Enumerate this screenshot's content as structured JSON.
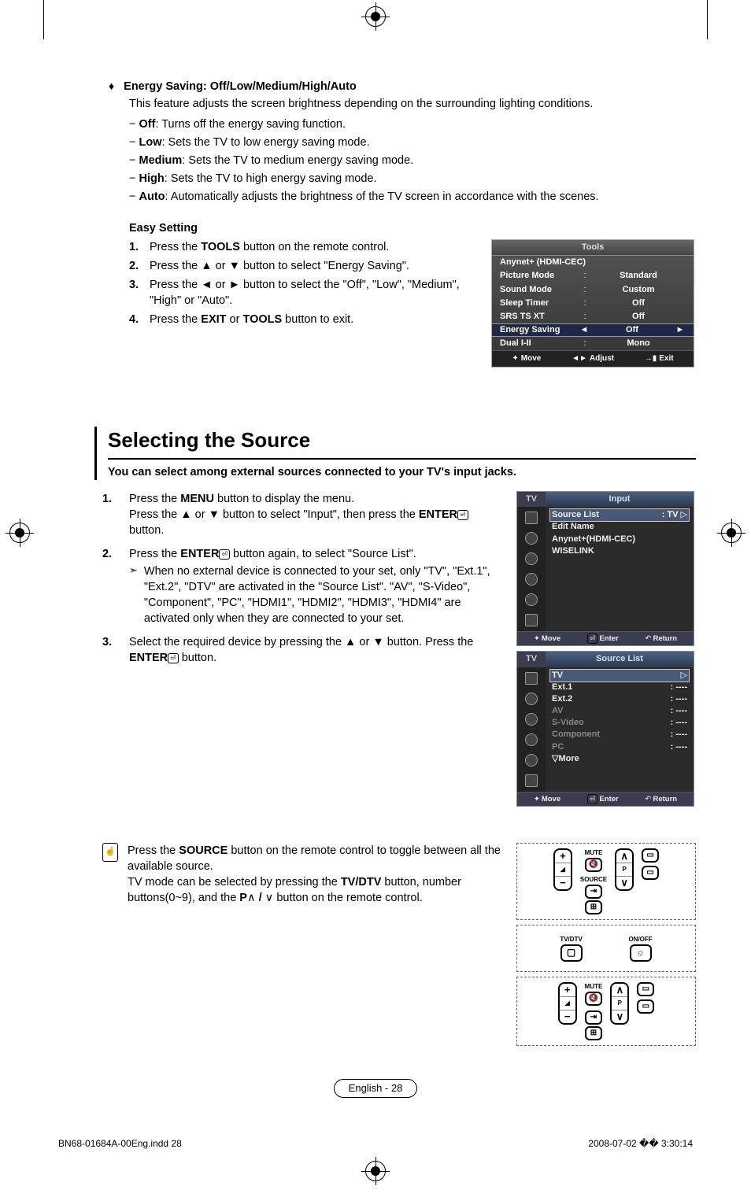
{
  "energy_saving": {
    "heading": "Energy Saving: Off/Low/Medium/High/Auto",
    "desc": "This feature adjusts the screen brightness depending on the surrounding lighting conditions.",
    "items": [
      {
        "term": "Off",
        "body": ": Turns off the energy saving function."
      },
      {
        "term": "Low",
        "body": ": Sets the TV to low energy saving mode."
      },
      {
        "term": "Medium",
        "body": ": Sets the TV to medium energy saving mode."
      },
      {
        "term": "High",
        "body": ": Sets the TV to high energy saving mode."
      },
      {
        "term": "Auto",
        "body": ": Automatically adjusts the brightness of the TV screen in accordance with the scenes."
      }
    ]
  },
  "easy_setting": {
    "title": "Easy Setting",
    "steps": [
      {
        "pre": "Press the ",
        "bold": "TOOLS",
        "post": " button on the remote control."
      },
      {
        "pre": "Press the ▲ or ▼ button to select \"Energy Saving\"."
      },
      {
        "pre": "Press the ◄ or ► button to select the \"Off\", \"Low\", \"Medium\", \"High\" or \"Auto\"."
      },
      {
        "pre": "Press the ",
        "bold": "EXIT",
        "mid": " or ",
        "bold2": "TOOLS",
        "post": " button to exit."
      }
    ]
  },
  "tools_osd": {
    "title": "Tools",
    "rows": [
      {
        "label": "Anynet+ (HDMI-CEC)",
        "val": ""
      },
      {
        "label": "Picture Mode",
        "val": "Standard"
      },
      {
        "label": "Sound Mode",
        "val": "Custom"
      },
      {
        "label": "Sleep Timer",
        "val": "Off"
      },
      {
        "label": "SRS TS XT",
        "val": "Off"
      },
      {
        "label": "Energy Saving",
        "val": "Off",
        "selected": true
      },
      {
        "label": "Dual I-II",
        "val": "Mono"
      }
    ],
    "footer": {
      "move": "Move",
      "adjust": "Adjust",
      "exit": "Exit"
    }
  },
  "selecting_source": {
    "title": "Selecting the Source",
    "intro": "You can select among external sources connected to your TV's input jacks.",
    "steps": {
      "s1a": "Press the ",
      "s1_menu": "MENU",
      "s1b": " button to display the menu.",
      "s1c": "Press the ▲ or ▼ button to select \"Input\", then press the ",
      "s1_enter": "ENTER",
      "s1d": " button.",
      "s2a": "Press the ",
      "s2_enter": "ENTER",
      "s2b": " button again, to select \"Source List\".",
      "s2_note": "When no external device is connected to your set, only \"TV\", \"Ext.1\", \"Ext.2\", \"DTV\" are activated in the \"Source List\". \"AV\", \"S-Video\", \"Component\", \"PC\", \"HDMI1\", \"HDMI2\", \"HDMI3\", \"HDMI4\" are activated only when they are connected to your set.",
      "s3a": "Select the required device by pressing the ▲ or ▼ button. Press the ",
      "s3_enter": "ENTER",
      "s3b": " button."
    }
  },
  "osd_input": {
    "tv": "TV",
    "title": "Input",
    "rows": [
      {
        "l": "Source List",
        "r": ": TV",
        "sel": true
      },
      {
        "l": "Edit Name",
        "r": ""
      },
      {
        "l": "Anynet+(HDMI-CEC)",
        "r": ""
      },
      {
        "l": "WISELINK",
        "r": ""
      }
    ],
    "footer": {
      "move": "Move",
      "enter": "Enter",
      "return": "Return"
    }
  },
  "osd_sourcelist": {
    "tv": "TV",
    "title": "Source List",
    "rows": [
      {
        "l": "TV",
        "r": "",
        "sel": true
      },
      {
        "l": "Ext.1",
        "r": ": ----"
      },
      {
        "l": "Ext.2",
        "r": ": ----"
      },
      {
        "l": "AV",
        "r": ": ----",
        "dim": true
      },
      {
        "l": "S-Video",
        "r": ": ----",
        "dim": true
      },
      {
        "l": "Component",
        "r": ": ----",
        "dim": true
      },
      {
        "l": "PC",
        "r": ": ----",
        "dim": true
      },
      {
        "l": "▽More",
        "r": ""
      }
    ],
    "footer": {
      "move": "Move",
      "enter": "Enter",
      "return": "Return"
    }
  },
  "remote_note": {
    "l1a": "Press the ",
    "l1_source": "SOURCE",
    "l1b": " button on the remote control to toggle between all the available source.",
    "l2a": "TV mode can be selected by pressing the ",
    "l2_tvdtv": "TV/DTV",
    "l2b": " button, number buttons(0~9), and the ",
    "l2_p": "P",
    "l2c": " button on the remote control."
  },
  "remote_labels": {
    "mute": "MUTE",
    "source": "SOURCE",
    "p": "P",
    "tvdtv": "TV/DTV",
    "onoff": "ON/OFF"
  },
  "page_badge": "English - 28",
  "indd": {
    "file": "BN68-01684A-00Eng.indd   28",
    "stamp": "2008-07-02   �� 3:30:14"
  }
}
